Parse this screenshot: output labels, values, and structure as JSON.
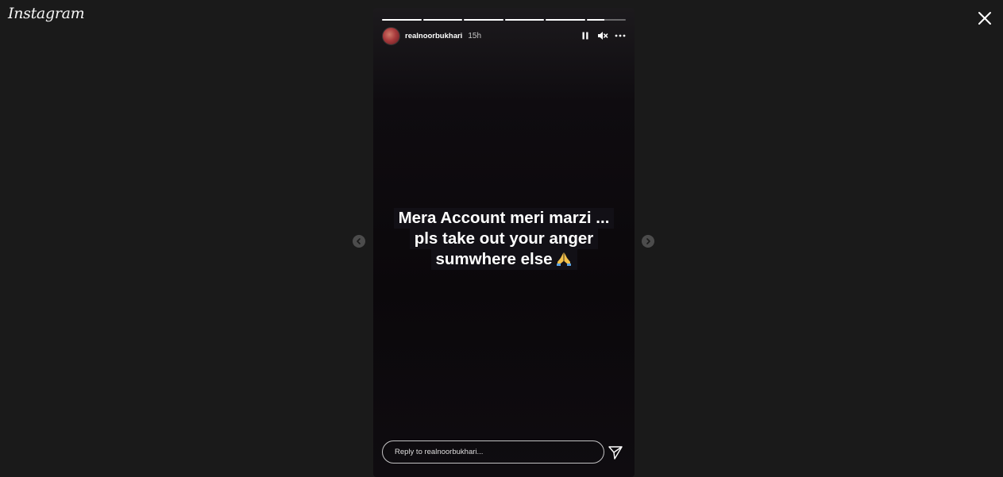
{
  "app": {
    "logo_text": "Instagram"
  },
  "story": {
    "progress": [
      1,
      1,
      1,
      1,
      1,
      0.45
    ],
    "username": "realnoorbukhari",
    "time": "15h",
    "caption_lines": [
      "Mera Account meri marzi ...",
      "pls take out your anger",
      "sumwhere else"
    ],
    "caption_emoji": "praying-hands-icon",
    "reply_placeholder": "Reply to realnoorbukhari..."
  },
  "icons": {
    "close": "close-icon",
    "pause": "pause-icon",
    "mute": "muted-speaker-icon",
    "more": "more-options-icon",
    "send": "send-icon",
    "prev": "chevron-left-icon",
    "next": "chevron-right-icon"
  },
  "colors": {
    "background": "#1a1a1a",
    "story_bg": "#0b080b",
    "text": "#ffffff"
  }
}
